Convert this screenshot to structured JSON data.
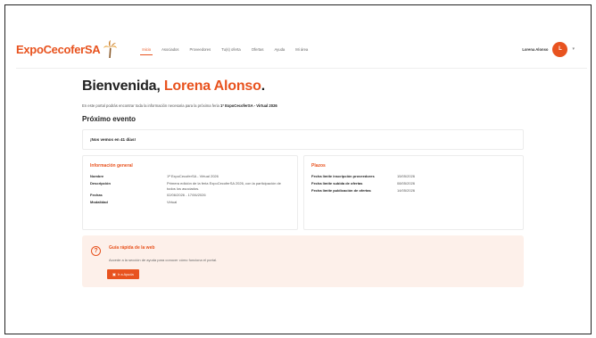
{
  "header": {
    "logo": "ExpoCecoferSA",
    "nav": [
      "Inicio",
      "Asociados",
      "Proveedores",
      "Tu(s) oferta",
      "Ofertas",
      "Ayuda",
      "Mi área"
    ],
    "active_index": 0,
    "user_name": "Lorena Alonso",
    "avatar_initial": "L"
  },
  "main": {
    "welcome_prefix": "Bienvenida,",
    "welcome_name": "Lorena Alonso",
    "welcome_suffix": ".",
    "intro_text": "En este portal podrás encontrar toda la información necesaria para la próxima feria",
    "intro_event": "1ª ExpoCecoferSA - Virtual 2026",
    "next_event_title": "Próximo evento",
    "countdown": "¡Nos vemos en 41 días!",
    "general": {
      "heading": "Información general",
      "rows": [
        {
          "k": "Nombre",
          "v": "1ª ExpoCecoferSA - Virtual 2026"
        },
        {
          "k": "Descripción",
          "v": "Primera edición de la feria ExpoCecoferSA 2026, con la participación de todos los asociados."
        },
        {
          "k": "Fechas",
          "v": "02/06/2026 - 17/06/2026"
        },
        {
          "k": "Modalidad",
          "v": "Virtual"
        }
      ]
    },
    "deadlines": {
      "heading": "Plazos",
      "rows": [
        {
          "k": "Fecha límite inscripción proveedores",
          "v": "15/05/2026"
        },
        {
          "k": "Fecha límite subida de ofertas",
          "v": "08/05/2026"
        },
        {
          "k": "Fecha límite publicación de ofertas",
          "v": "14/05/2026"
        }
      ]
    },
    "guide": {
      "title": "Guía rápida de la web",
      "text": "Accede a la sección de ayuda para conocer cómo funciona el portal.",
      "button": "Ir a Ayuda"
    }
  },
  "colors": {
    "accent": "#e8531f",
    "guide_bg": "#fdf0ea"
  }
}
